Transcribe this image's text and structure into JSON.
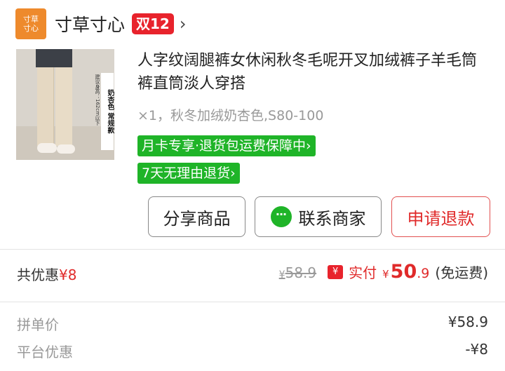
{
  "store": {
    "logo_text_1": "寸草",
    "logo_text_2": "寸心",
    "name": "寸草寸心",
    "badge": "双12",
    "arrow": "›"
  },
  "product": {
    "image_tag_main": "奶杏色 常规款",
    "image_tag_side": "建议身高：162cm以下",
    "title": "人字纹阔腿裤女休闲秋冬毛呢开叉加绒裤子羊毛筒裤直筒淡人穿搭",
    "spec": "×1，秋冬加绒奶杏色,S80-100",
    "promos": [
      "月卡专享·退货包运费保障中›",
      "7天无理由退货›"
    ]
  },
  "actions": {
    "share": "分享商品",
    "contact": "联系商家",
    "refund": "申请退款"
  },
  "summary": {
    "discount_label": "共优惠",
    "discount_amount": "¥8",
    "original_symbol": "¥",
    "original_price": "58.9",
    "pay_icon": "¥",
    "pay_label": "实付",
    "pay_symbol": "¥",
    "pay_int": "50",
    "pay_dec": ".9",
    "shipping": "(免运费)"
  },
  "details": [
    {
      "label": "拼单价",
      "value": "¥58.9"
    },
    {
      "label": "平台优惠",
      "value": "-¥8"
    }
  ],
  "colors": {
    "brand_orange": "#ee8a2c",
    "accent_red": "#e02a2a",
    "promo_green": "#1fb428"
  }
}
